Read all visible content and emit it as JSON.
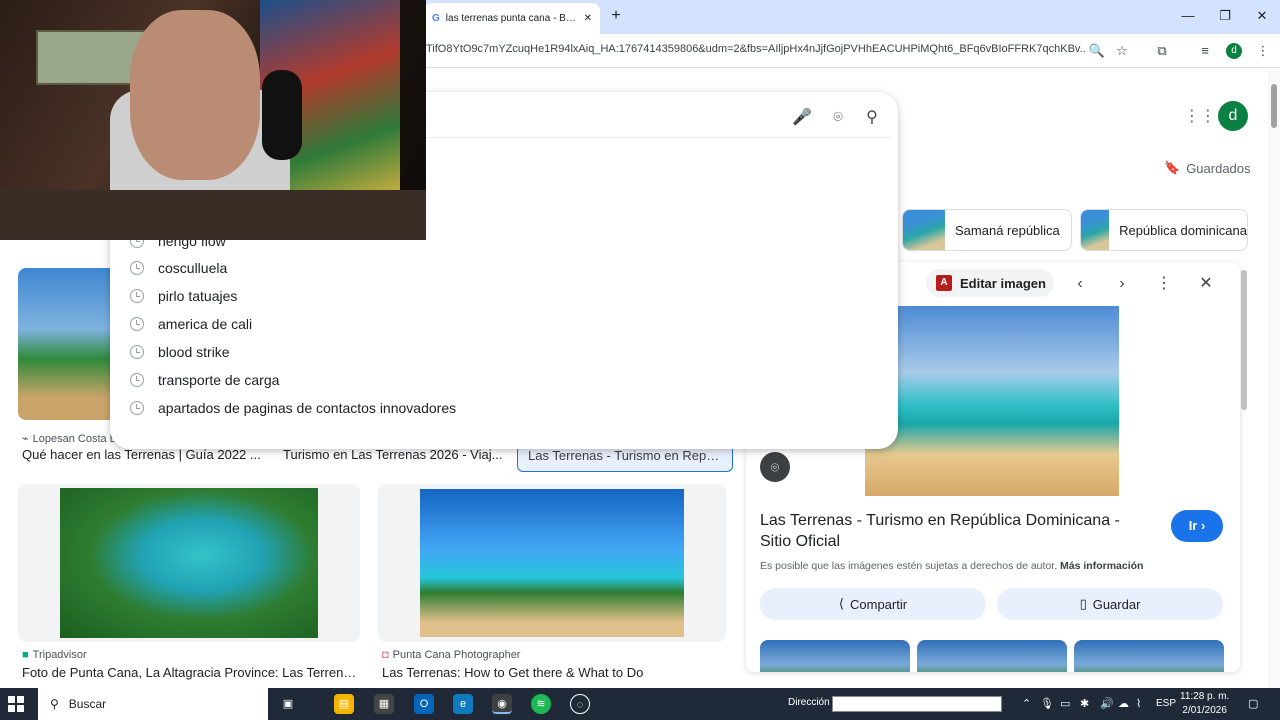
{
  "browser": {
    "tab_title": "las terrenas punta cana - Buscar",
    "new_tab": "+",
    "url": "TifO8YtO9c7mYZcuqHe1R94lxAiq_HA:1767414359806&udm=2&fbs=AIljpHx4nJjfGojPVHhEACUHPiMQht6_BFq6vBIoFFRK7qchKBv..."
  },
  "search": {
    "suggestions": [
      "ñengo flow",
      "cosculluela",
      "pirlo tatuajes",
      "america de cali",
      "blood strike",
      "transporte de carga",
      "apartados de paginas de contactos innovadores"
    ]
  },
  "header": {
    "avatar_letter": "d",
    "saved_label": "Guardados"
  },
  "chips": [
    {
      "label": "Samaná república"
    },
    {
      "label": "República dominicana"
    }
  ],
  "results": [
    {
      "source": "Lopesan Costa Bávaro",
      "title": "Qué hacer en las Terrenas | Guía 2022 ..."
    },
    {
      "source": "",
      "title": "Turismo en Las Terrenas 2026 - Viaj..."
    },
    {
      "source": "",
      "title": "Las Terrenas - Turismo en Repú..."
    },
    {
      "source": "Tripadvisor",
      "title": "Foto de Punta Cana, La Altagracia Province: Las Terrena..."
    },
    {
      "source": "Punta Cana Photographer",
      "title": "Las Terrenas: How to Get there & What to Do"
    }
  ],
  "panel": {
    "edit_label": "Editar imagen",
    "title": "Las Terrenas - Turismo en República Dominicana - Sitio Oficial",
    "go_label": "Ir",
    "note": "Es posible que las imágenes estén sujetas a derechos de autor.",
    "more_info": "Más información",
    "share_label": "Compartir",
    "save_label": "Guardar"
  },
  "taskbar": {
    "search_label": "Buscar",
    "direction_label": "Dirección",
    "language": "ESP",
    "time": "11:28 p. m.",
    "date": "2/01/2026"
  },
  "colors": {
    "accent": "#1a73e8",
    "tabstrip": "#d3e3fd",
    "taskbar": "#1f2937"
  }
}
